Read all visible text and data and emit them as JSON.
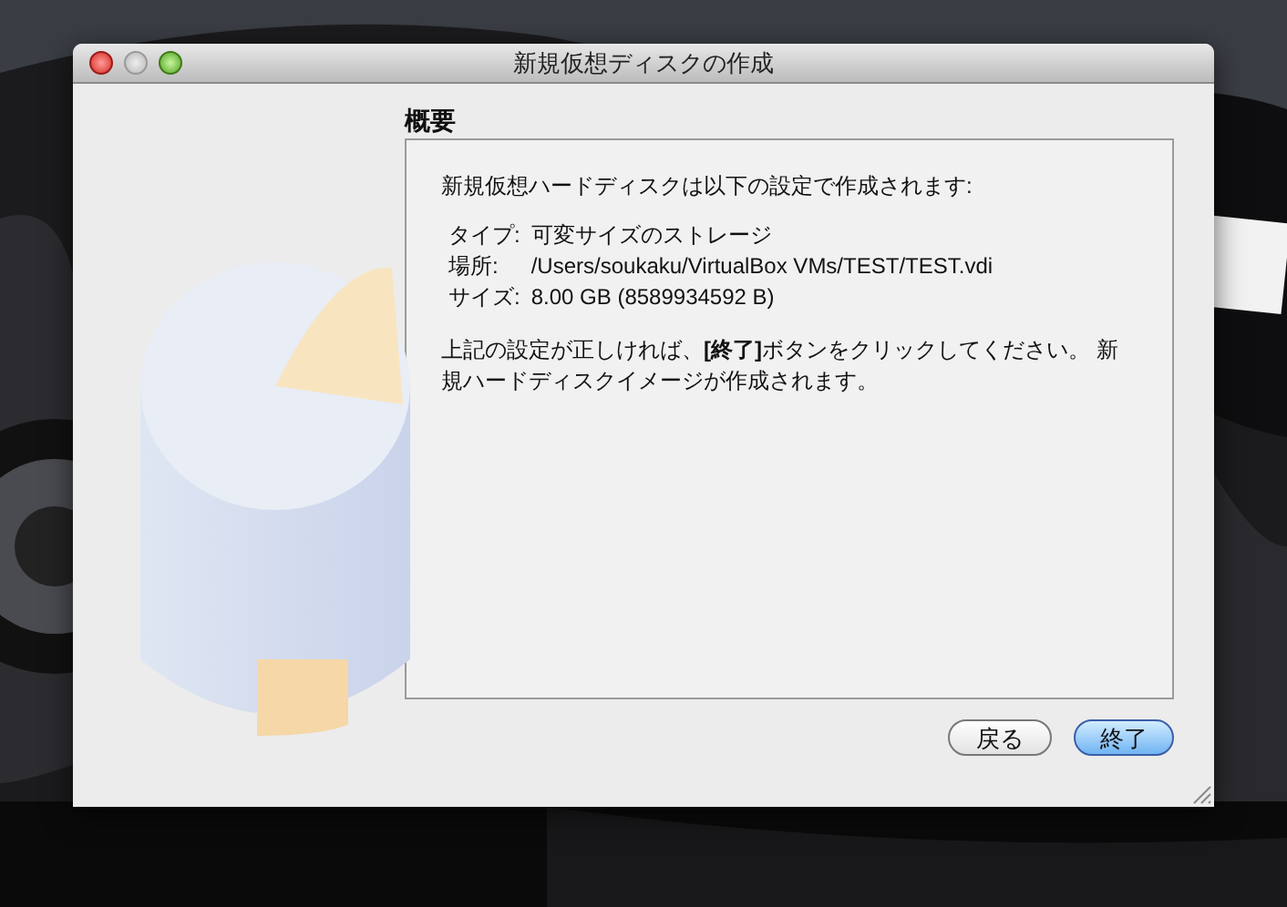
{
  "window": {
    "title": "新規仮想ディスクの作成"
  },
  "heading": "概要",
  "summary": {
    "intro": "新規仮想ハードディスクは以下の設定で作成されます:",
    "details": [
      {
        "label": "タイプ:",
        "value": "可変サイズのストレージ"
      },
      {
        "label": "場所:",
        "value": "/Users/soukaku/VirtualBox VMs/TEST/TEST.vdi"
      },
      {
        "label": "サイズ:",
        "value": "8.00 GB (8589934592 B)"
      }
    ],
    "note": "上記の設定が正しければ、**[終了]**ボタンをクリックしてください。 新規ハードディスクイメージが作成されます。"
  },
  "buttons": [
    {
      "label": "戻る",
      "default": false
    },
    {
      "label": "終了",
      "default": true
    }
  ]
}
